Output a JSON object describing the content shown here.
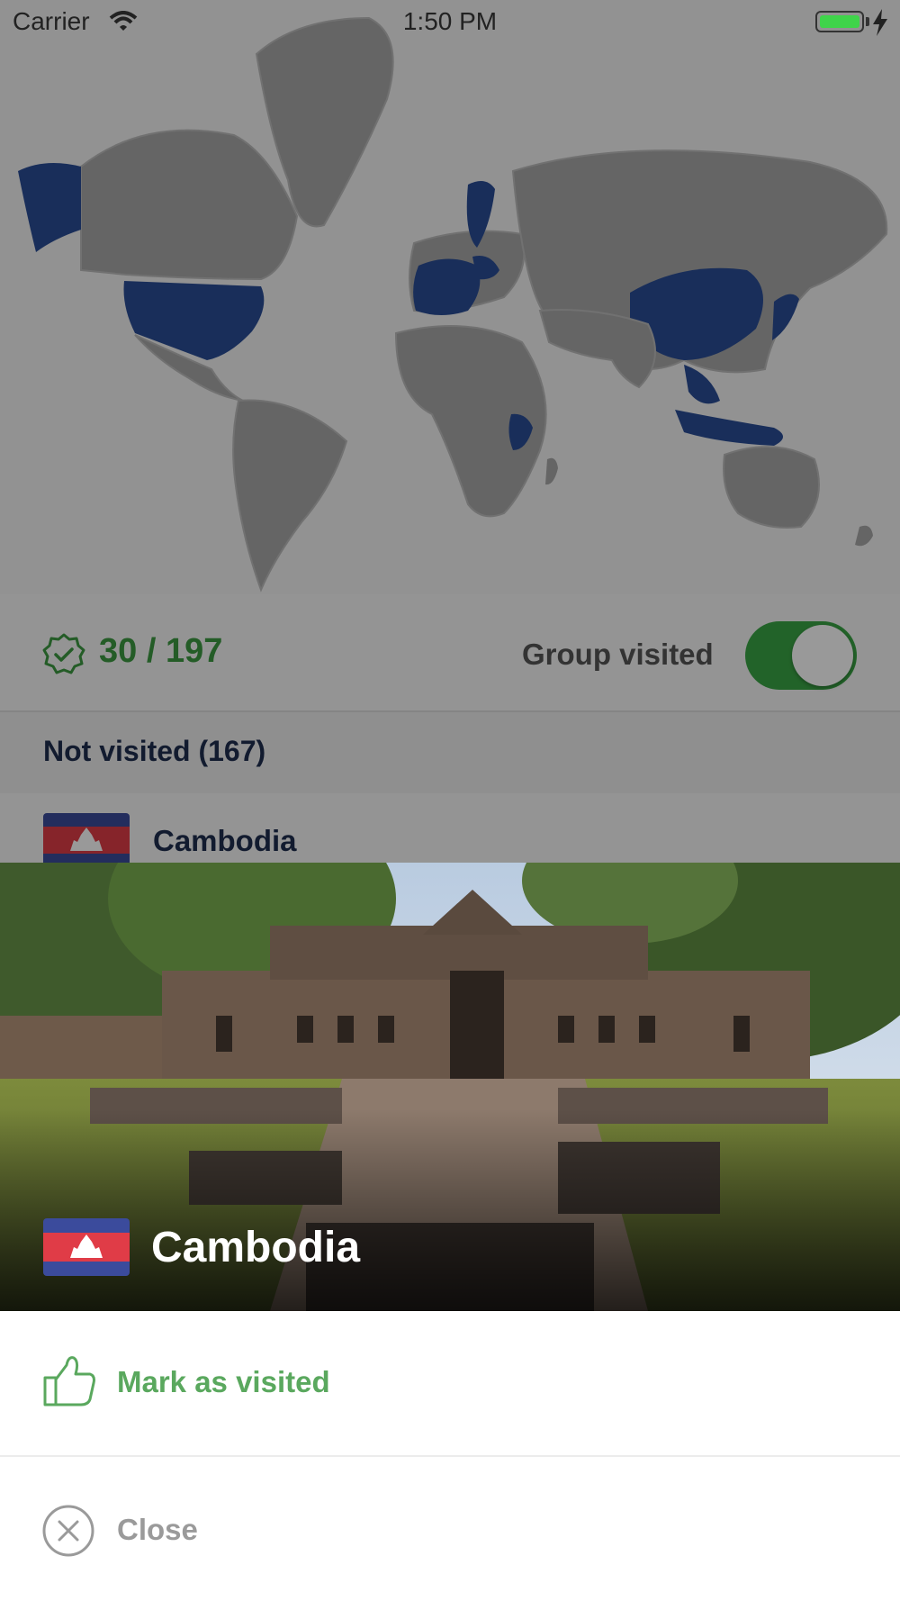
{
  "status_bar": {
    "carrier": "Carrier",
    "time": "1:50 PM"
  },
  "stats": {
    "visited_count": "30 / 197",
    "group_label": "Group visited",
    "group_toggle_on": true
  },
  "list": {
    "section_title": "Not visited (167)",
    "first_row": "Cambodia"
  },
  "sheet": {
    "country_name": "Cambodia",
    "mark_visited_label": "Mark as visited",
    "close_label": "Close"
  },
  "colors": {
    "visited_blue": "#2b4e97",
    "accent_green": "#3aa545",
    "flag_blue": "#3b4b9c",
    "flag_red": "#e03c47"
  },
  "icons": {
    "badge": "verified-badge-icon",
    "thumb": "thumbs-up-icon",
    "close": "close-circle-icon"
  }
}
